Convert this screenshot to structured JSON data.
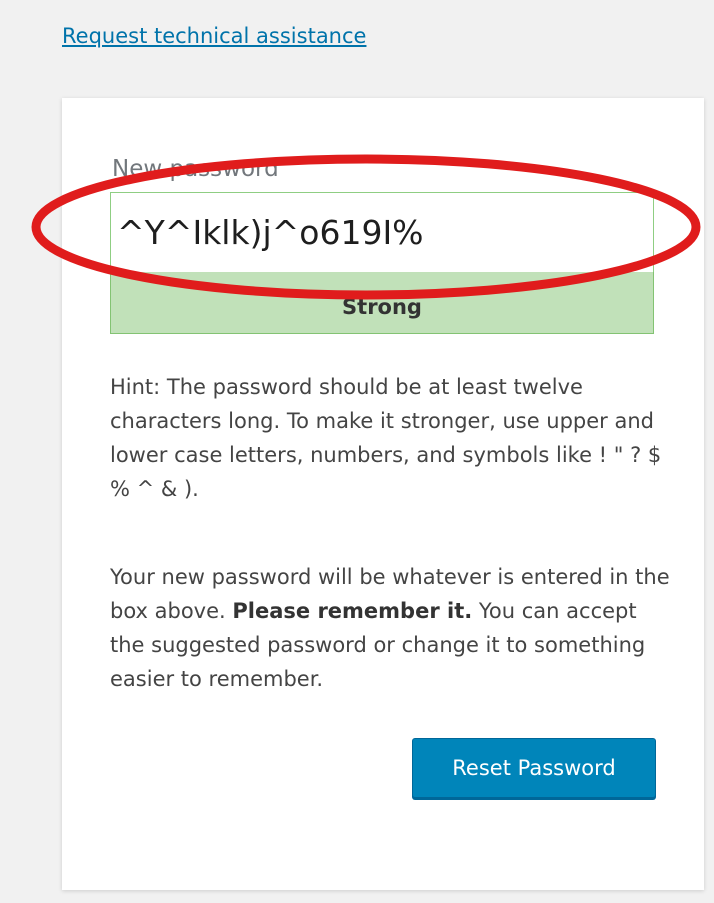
{
  "links": {
    "help": "Request technical assistance"
  },
  "reset_form": {
    "password_label": "New password",
    "password_value": "^Y^Iklk)j^o619I%",
    "strength_text": "Strong",
    "hint_text": "Hint: The password should be at least twelve characters long. To make it stronger, use upper and lower case letters, numbers, and symbols like ! \" ? $ % ^ & ).",
    "notice_before": "Your new password will be whatever is entered in the box above. ",
    "notice_bold": "Please remember it.",
    "notice_after": " You can accept the suggested password or change it to something easier to remember.",
    "submit_label": "Reset Password"
  },
  "colors": {
    "link": "#0073aa",
    "strength_strong_bg": "#c1e1b9",
    "primary_button": "#0085ba",
    "annotation_ellipse": "#e01c1c"
  }
}
